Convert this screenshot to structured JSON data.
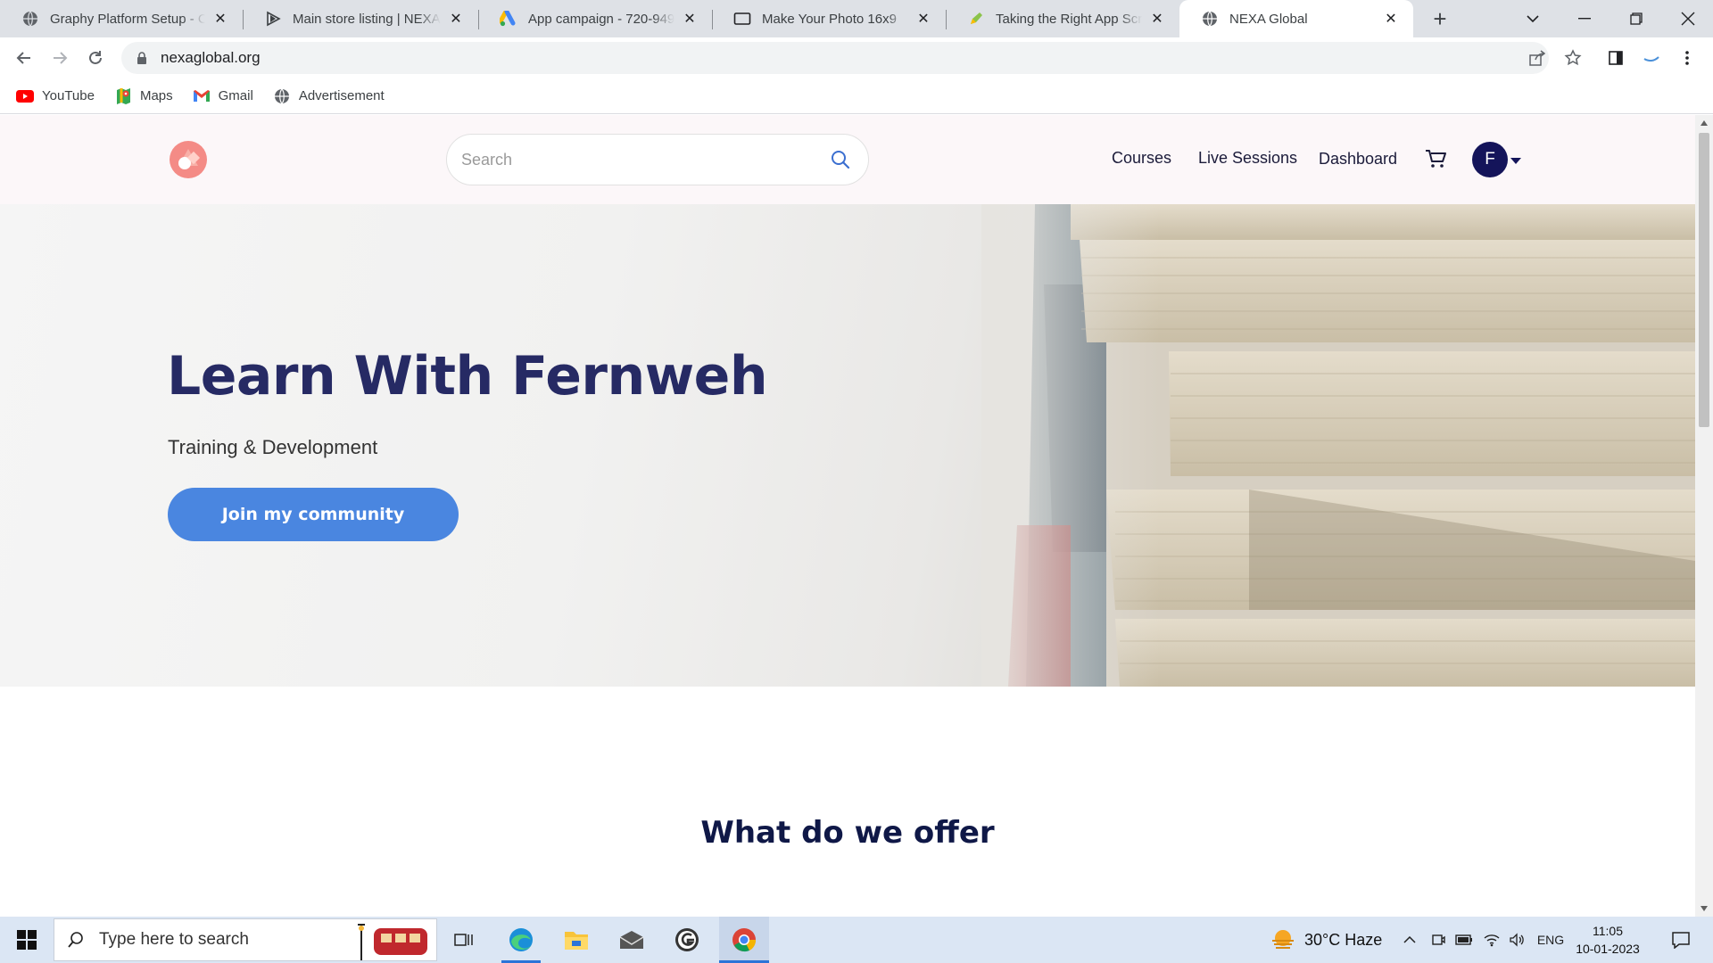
{
  "browser": {
    "tabs": [
      {
        "title": "Graphy Platform Setup - Co",
        "active": false
      },
      {
        "title": "Main store listing | NEXA Gl",
        "active": false
      },
      {
        "title": "App campaign - 720-949-4",
        "active": false
      },
      {
        "title": "Make Your Photo 16x9",
        "active": false
      },
      {
        "title": "Taking the Right App Scree",
        "active": false
      },
      {
        "title": "NEXA Global",
        "active": true
      }
    ],
    "url": "nexaglobal.org",
    "bookmarks": [
      {
        "label": "YouTube",
        "icon": "youtube-icon"
      },
      {
        "label": "Maps",
        "icon": "maps-icon"
      },
      {
        "label": "Gmail",
        "icon": "gmail-icon"
      },
      {
        "label": "Advertisement",
        "icon": "globe-icon"
      }
    ]
  },
  "site": {
    "search_placeholder": "Search",
    "nav": {
      "courses": "Courses",
      "live_sessions": "Live Sessions",
      "dashboard": "Dashboard"
    },
    "avatar_initial": "F",
    "hero": {
      "title": "Learn With Fernweh",
      "subtitle": "Training & Development",
      "cta": "Join my community"
    },
    "section_title": "What do we offer",
    "colors": {
      "heading": "#262a64",
      "cta": "#4a86e0",
      "avatar": "#14145a"
    }
  },
  "taskbar": {
    "search_placeholder": "Type here to search",
    "weather": "30°C  Haze",
    "language": "ENG",
    "time": "11:05",
    "date": "10-01-2023"
  }
}
